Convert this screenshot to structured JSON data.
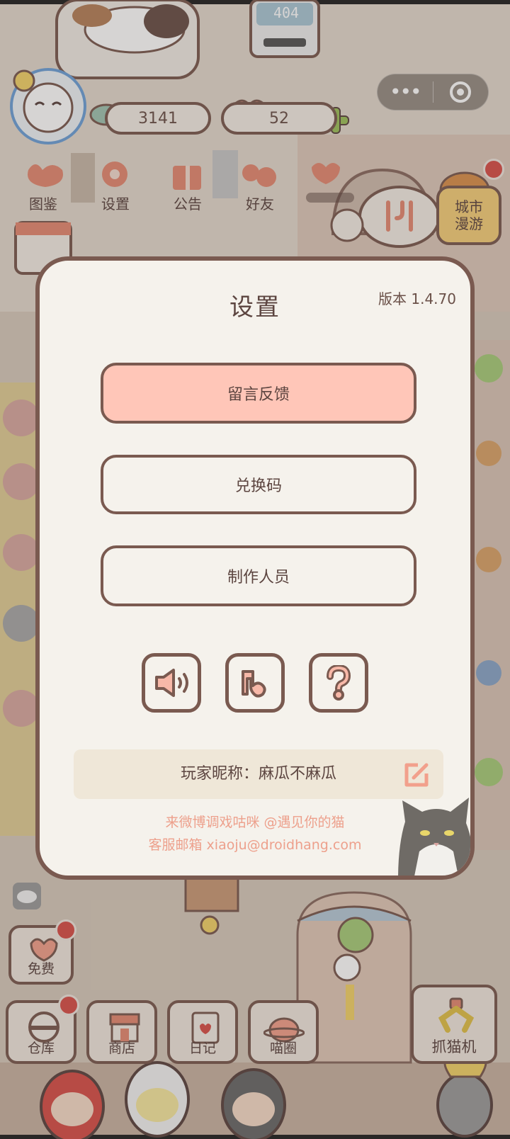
{
  "hud": {
    "coins": "3141",
    "hearts": "52",
    "menu": {
      "illustrated": "图鉴",
      "settings": "设置",
      "notice": "公告",
      "friends": "好友"
    },
    "screen_sign": "404",
    "city_tour": "城市\n漫游"
  },
  "bottom": {
    "free": "免费",
    "warehouse": "仓库",
    "shop": "商店",
    "diary": "日记",
    "circle": "喵圈",
    "claw_machine": "抓猫机"
  },
  "dialog": {
    "title": "设置",
    "version": "版本 1.4.70",
    "buttons": {
      "feedback": "留言反馈",
      "redeem": "兑换码",
      "credits": "制作人员"
    },
    "icons": [
      "speaker-icon",
      "music-note-icon",
      "question-icon"
    ],
    "nickname_label": "玩家昵称：",
    "nickname_value": "麻瓜不麻瓜",
    "weibo": "来微博调戏咕咪 @遇见你的猫",
    "email": "客服邮箱 xiaoju@droidhang.com"
  },
  "colors": {
    "accent": "#ffc6b8",
    "border": "#7a5a50",
    "dialog_bg": "#f5f2ec",
    "link": "#eda08c",
    "badge": "#d8504a"
  }
}
